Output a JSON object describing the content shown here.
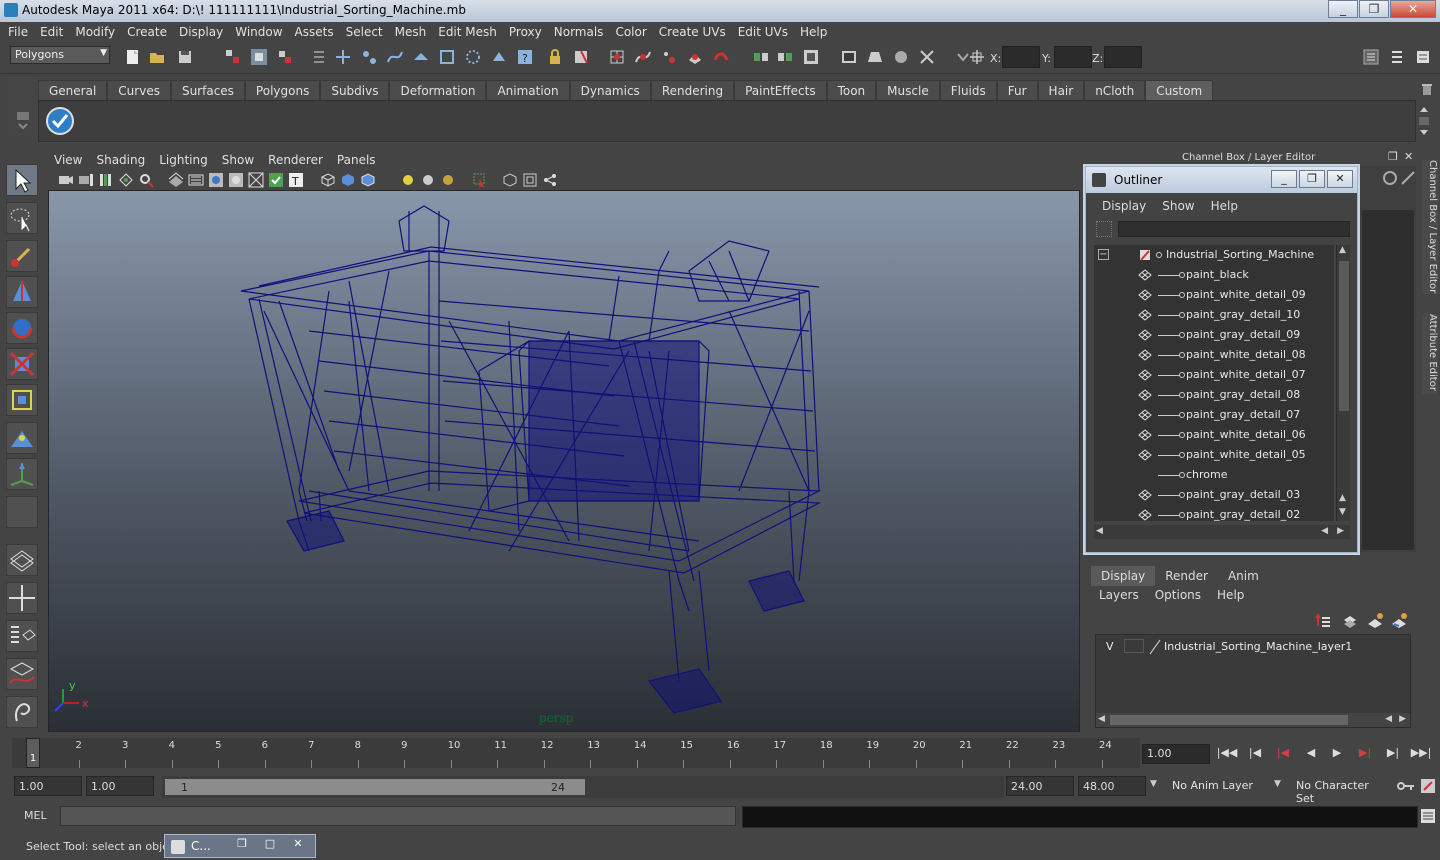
{
  "window": {
    "title": "Autodesk Maya 2011 x64: D:\\! 111111111\\Industrial_Sorting_Machine.mb",
    "buttons": [
      "_",
      "❐",
      "✕"
    ]
  },
  "menubar": [
    "File",
    "Edit",
    "Modify",
    "Create",
    "Display",
    "Window",
    "Assets",
    "Select",
    "Mesh",
    "Edit Mesh",
    "Proxy",
    "Normals",
    "Color",
    "Create UVs",
    "Edit UVs",
    "Help"
  ],
  "statusline": {
    "mode": "Polygons",
    "x_label": "X:",
    "y_label": "Y:",
    "z_label": "Z:"
  },
  "shelf": {
    "tabs": [
      "General",
      "Curves",
      "Surfaces",
      "Polygons",
      "Subdivs",
      "Deformation",
      "Animation",
      "Dynamics",
      "Rendering",
      "PaintEffects",
      "Toon",
      "Muscle",
      "Fluids",
      "Fur",
      "Hair",
      "nCloth",
      "Custom"
    ],
    "active_tab": "Custom"
  },
  "viewport": {
    "menu": [
      "View",
      "Shading",
      "Lighting",
      "Show",
      "Renderer",
      "Panels"
    ],
    "camera_label": "persp",
    "axis_y": "y",
    "axis_x": "x"
  },
  "channel_box": {
    "header": "Channel Box / Layer Editor",
    "side_tabs": [
      "Channel Box / Layer Editor",
      "Attribute Editor"
    ]
  },
  "outliner": {
    "title": "Outliner",
    "menu": [
      "Display",
      "Show",
      "Help"
    ],
    "expand_toggle": "−",
    "root": "Industrial_Sorting_Machine",
    "items": [
      "paint_black",
      "paint_white_detail_09",
      "paint_gray_detail_10",
      "paint_gray_detail_09",
      "paint_white_detail_08",
      "paint_white_detail_07",
      "paint_gray_detail_08",
      "paint_gray_detail_07",
      "paint_white_detail_06",
      "paint_white_detail_05",
      "chrome",
      "paint_gray_detail_03",
      "paint_gray_detail_02"
    ]
  },
  "layer_editor": {
    "tabs": [
      "Display",
      "Render",
      "Anim"
    ],
    "active_tab": "Display",
    "menu": [
      "Layers",
      "Options",
      "Help"
    ],
    "layer": {
      "visible": "V",
      "name": "Industrial_Sorting_Machine_layer1"
    }
  },
  "timeline": {
    "ticks": [
      "1",
      "2",
      "3",
      "4",
      "5",
      "6",
      "7",
      "8",
      "9",
      "10",
      "11",
      "12",
      "13",
      "14",
      "15",
      "16",
      "17",
      "18",
      "19",
      "20",
      "21",
      "22",
      "23",
      "24"
    ],
    "current_marker": "1",
    "current_frame": "1.00"
  },
  "range": {
    "start": "1.00",
    "playback_start": "1.00",
    "bar_start": "1",
    "bar_end": "24",
    "playback_end": "24.00",
    "end": "48.00",
    "anim_layer": "No Anim Layer",
    "character_set": "No Character Set"
  },
  "command_line": {
    "label": "MEL"
  },
  "help_line": {
    "text": "Select Tool: select an object"
  },
  "minimized_window": {
    "title": "C..."
  },
  "colors": {
    "wireframe": "#10107a",
    "background": "#444444"
  }
}
